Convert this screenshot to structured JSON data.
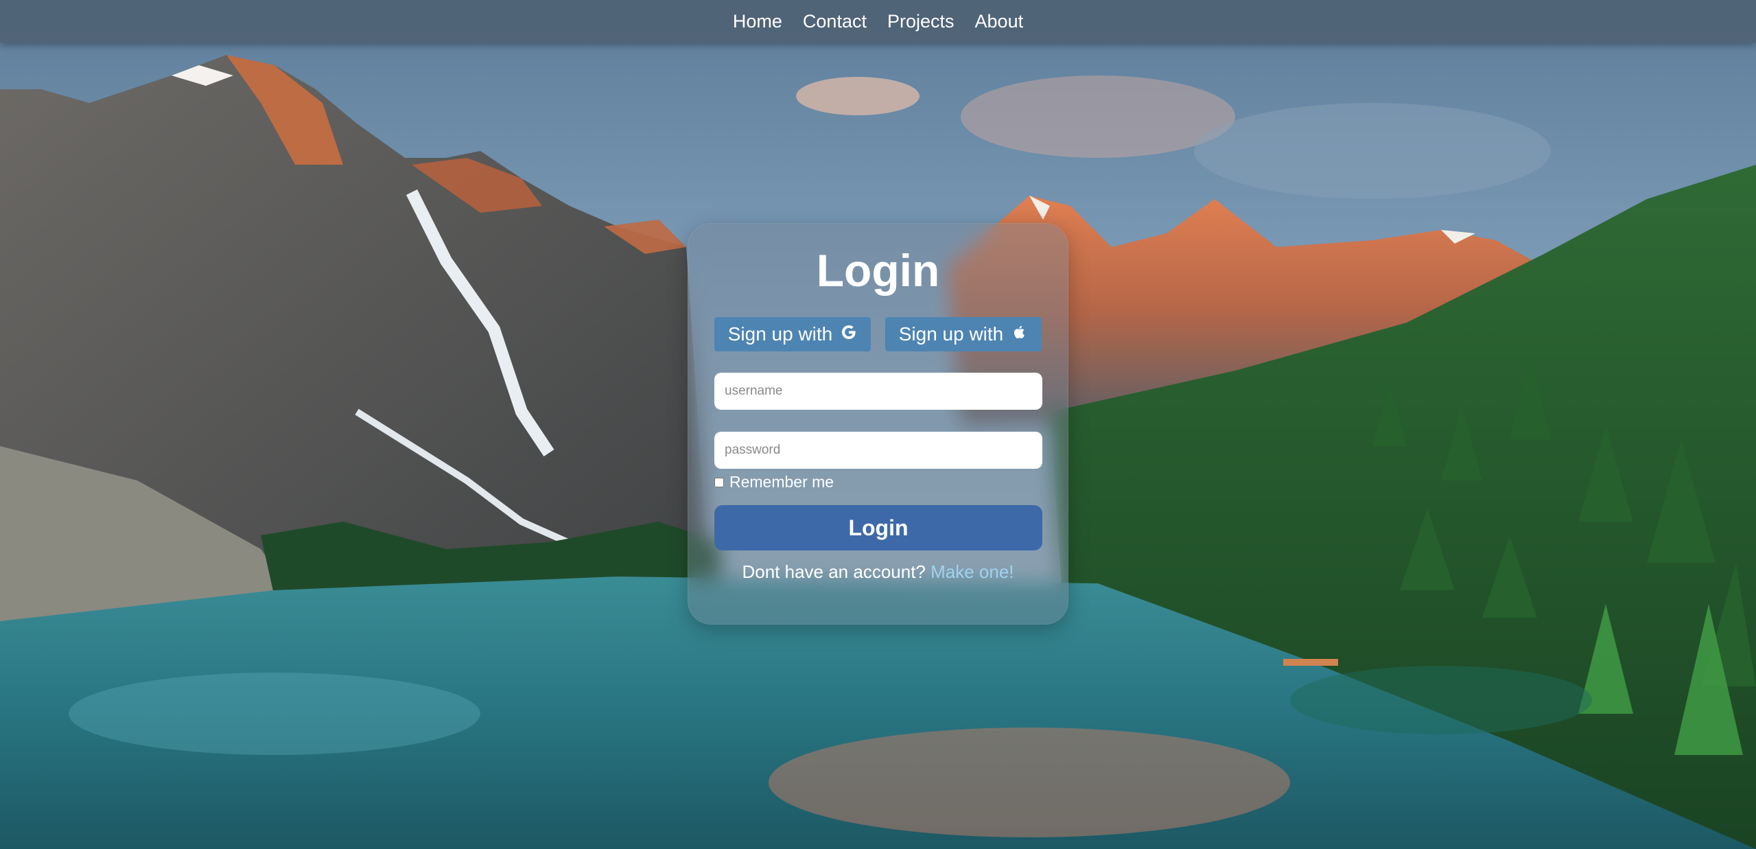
{
  "nav": {
    "items": [
      {
        "label": "Home"
      },
      {
        "label": "Contact"
      },
      {
        "label": "Projects"
      },
      {
        "label": "About"
      }
    ]
  },
  "login_card": {
    "title": "Login",
    "social_buttons": [
      {
        "label": "Sign up with",
        "icon": "google-icon"
      },
      {
        "label": "Sign up with",
        "icon": "apple-icon"
      }
    ],
    "username": {
      "placeholder": "username",
      "value": ""
    },
    "password": {
      "placeholder": "password",
      "value": ""
    },
    "remember_label": "Remember me",
    "remember_checked": false,
    "submit_label": "Login",
    "signup_prompt": "Dont have an account?",
    "signup_link": "Make one!"
  },
  "colors": {
    "nav_bg": "#4e6072",
    "social_button": "#4d84b2",
    "login_button": "#3d69a8",
    "link": "#9fd3ee"
  }
}
